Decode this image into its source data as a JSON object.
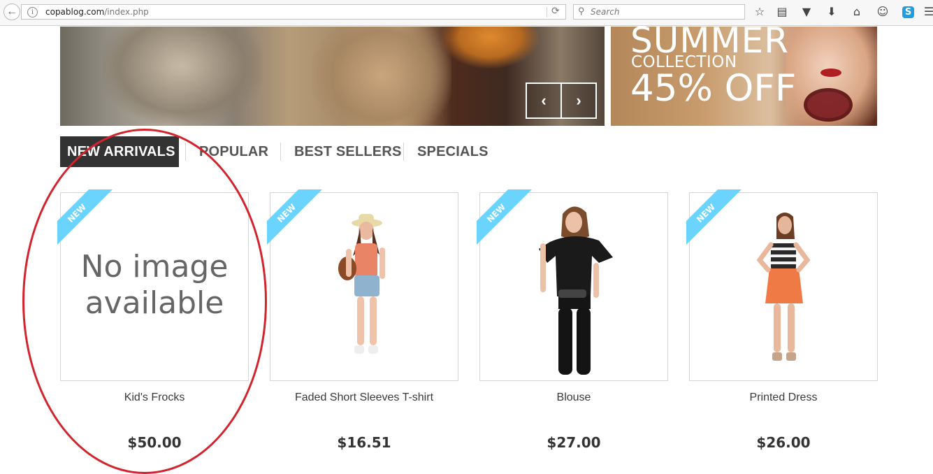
{
  "browser": {
    "url_domain": "copablog.com",
    "url_path": "/index.php",
    "search_placeholder": "Search",
    "toolbar_icons": [
      "star-icon",
      "reading-list-icon",
      "pocket-icon",
      "download-icon",
      "home-icon",
      "chat-icon",
      "skype-icon",
      "menu-icon"
    ]
  },
  "hero": {
    "prev_arrow": "‹",
    "next_arrow": "›",
    "promo_line1": "SUMMER",
    "promo_line2": "COLLECTION",
    "promo_line3": "45% OFF"
  },
  "tabs": [
    {
      "label": "NEW ARRIVALS",
      "active": true
    },
    {
      "label": "POPULAR",
      "active": false
    },
    {
      "label": "BEST SELLERS",
      "active": false
    },
    {
      "label": "SPECIALS",
      "active": false
    }
  ],
  "products": [
    {
      "name": "Kid's Frocks",
      "price": "$50.00",
      "badge": "NEW",
      "placeholder": "No image available"
    },
    {
      "name": "Faded Short Sleeves T-shirt",
      "price": "$16.51",
      "badge": "NEW"
    },
    {
      "name": "Blouse",
      "price": "$27.00",
      "badge": "NEW"
    },
    {
      "name": "Printed Dress",
      "price": "$26.00",
      "badge": "NEW"
    }
  ],
  "colors": {
    "ribbon": "#6ad4ff",
    "active_tab_bg": "#333333",
    "annotation": "#d3242d"
  }
}
